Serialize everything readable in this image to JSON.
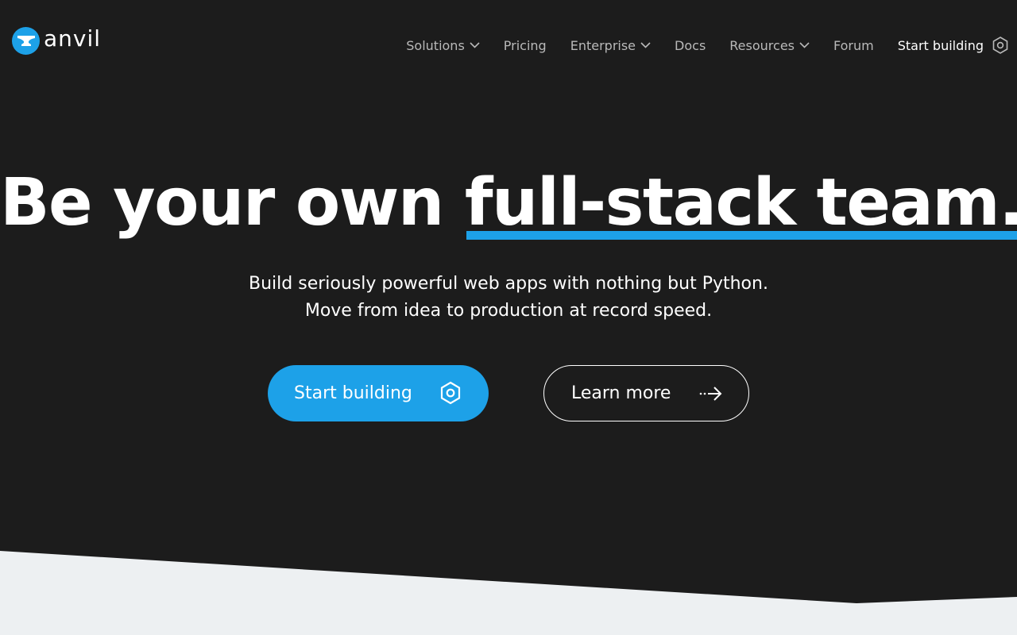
{
  "brand": {
    "name": "anvil"
  },
  "nav": {
    "items": [
      {
        "label": "Solutions",
        "has_dropdown": true
      },
      {
        "label": "Pricing",
        "has_dropdown": false
      },
      {
        "label": "Enterprise",
        "has_dropdown": true
      },
      {
        "label": "Docs",
        "has_dropdown": false
      },
      {
        "label": "Resources",
        "has_dropdown": true
      },
      {
        "label": "Forum",
        "has_dropdown": false
      }
    ],
    "cta_label": "Start building"
  },
  "hero": {
    "title_plain": "Be your own ",
    "title_highlight": "full-stack team.",
    "subtitle_line1": "Build seriously powerful web apps with nothing but Python.",
    "subtitle_line2": "Move from idea to production at record speed.",
    "primary_button": "Start building",
    "secondary_button": "Learn more"
  },
  "colors": {
    "background": "#1c1c1c",
    "accent": "#1da1e8",
    "nav_text": "#b9b9b9",
    "light_section": "#edf0f2"
  },
  "icons": {
    "logo": "anvil-logo-icon",
    "dropdown": "chevron-down-icon",
    "cta": "hexagon-nut-icon",
    "learn_more": "dashed-arrow-right-icon"
  }
}
